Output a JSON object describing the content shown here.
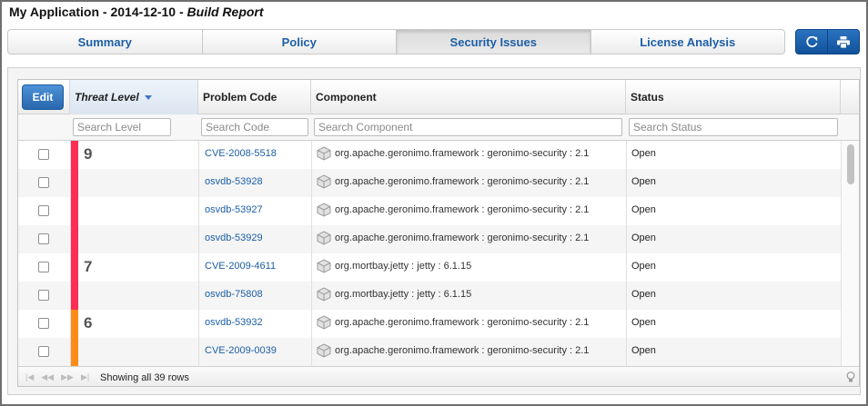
{
  "title": {
    "app": "My Application - 2014-12-10 -",
    "report": "Build Report"
  },
  "tabs": [
    {
      "label": "Summary",
      "active": false
    },
    {
      "label": "Policy",
      "active": false
    },
    {
      "label": "Security Issues",
      "active": true
    },
    {
      "label": "License Analysis",
      "active": false
    }
  ],
  "toolbar": {
    "refresh_icon": "refresh-icon",
    "print_icon": "print-icon"
  },
  "grid": {
    "edit_label": "Edit",
    "columns": {
      "threat": "Threat Level",
      "code": "Problem Code",
      "component": "Component",
      "status": "Status"
    },
    "filters": {
      "threat": "Search Level",
      "code": "Search Code",
      "component": "Search Component",
      "status": "Search Status"
    },
    "rows": [
      {
        "level": "9",
        "level_color": "#ff2d55",
        "code": "CVE-2008-5518",
        "component": "org.apache.geronimo.framework : geronimo-security : 2.1",
        "status": "Open"
      },
      {
        "level": "",
        "level_color": "#ff2d55",
        "code": "osvdb-53928",
        "component": "org.apache.geronimo.framework : geronimo-security : 2.1",
        "status": "Open"
      },
      {
        "level": "",
        "level_color": "#ff2d55",
        "code": "osvdb-53927",
        "component": "org.apache.geronimo.framework : geronimo-security : 2.1",
        "status": "Open"
      },
      {
        "level": "",
        "level_color": "#ff2d55",
        "code": "osvdb-53929",
        "component": "org.apache.geronimo.framework : geronimo-security : 2.1",
        "status": "Open"
      },
      {
        "level": "7",
        "level_color": "#ff2d55",
        "code": "CVE-2009-4611",
        "component": "org.mortbay.jetty : jetty : 6.1.15",
        "status": "Open"
      },
      {
        "level": "",
        "level_color": "#ff2d55",
        "code": "osvdb-75808",
        "component": "org.mortbay.jetty : jetty : 6.1.15",
        "status": "Open"
      },
      {
        "level": "6",
        "level_color": "#ff8c1a",
        "code": "osvdb-53932",
        "component": "org.apache.geronimo.framework : geronimo-security : 2.1",
        "status": "Open"
      },
      {
        "level": "",
        "level_color": "#ff8c1a",
        "code": "CVE-2009-0039",
        "component": "org.apache.geronimo.framework : geronimo-security : 2.1",
        "status": "Open"
      }
    ],
    "footer": {
      "rows_text": "Showing all 39 rows"
    }
  }
}
